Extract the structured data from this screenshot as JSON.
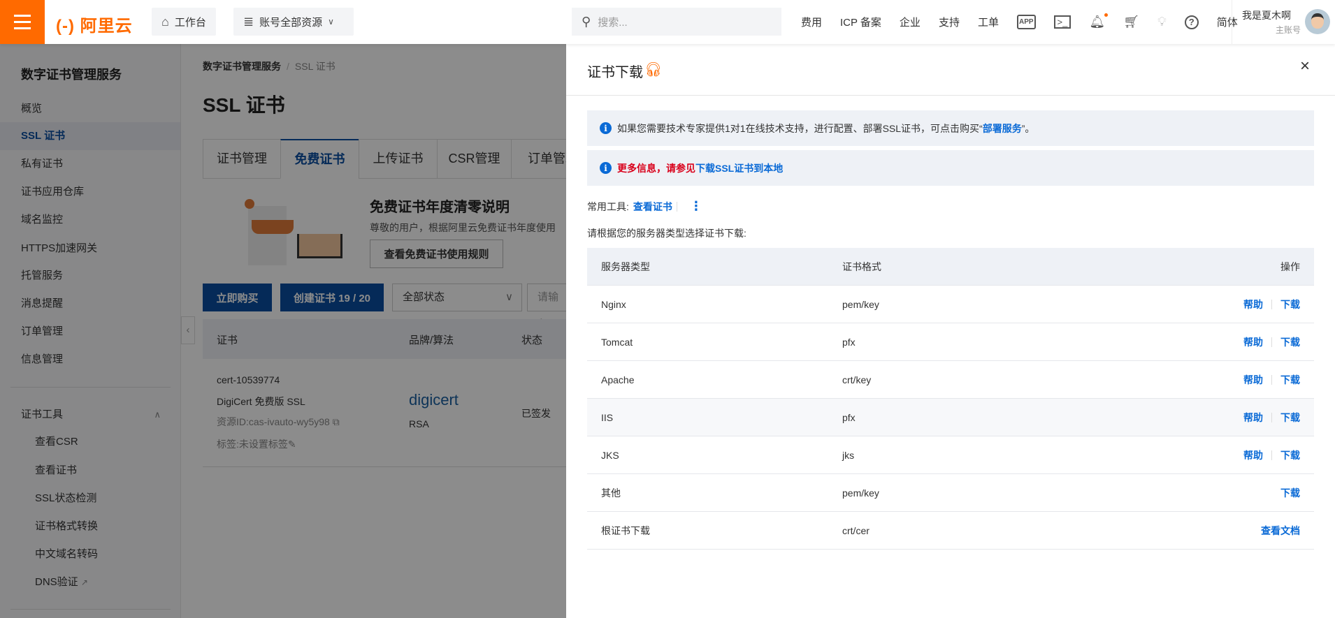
{
  "header": {
    "logo": "(-) 阿里云",
    "workbench": "工作台",
    "resources": "账号全部资源",
    "search_placeholder": "搜索...",
    "nav": [
      "费用",
      "ICP 备案",
      "企业",
      "支持",
      "工单"
    ],
    "lang": "简体",
    "user_name": "我是夏木啊",
    "user_role": "主账号",
    "accent": "#ff6a00"
  },
  "sidebar": {
    "title": "数字证书管理服务",
    "items": [
      "概览",
      "SSL 证书",
      "私有证书",
      "证书应用仓库",
      "域名监控",
      "HTTPS加速网关",
      "托管服务",
      "消息提醒",
      "订单管理",
      "信息管理"
    ],
    "active": "SSL 证书",
    "group": "证书工具",
    "sub_items": [
      "查看CSR",
      "查看证书",
      "SSL状态检测",
      "证书格式转换",
      "中文域名转码",
      "DNS验证"
    ]
  },
  "main": {
    "breadcrumb": [
      "数字证书管理服务",
      "SSL 证书"
    ],
    "title": "SSL 证书",
    "tabs": [
      "证书管理",
      "免费证书",
      "上传证书",
      "CSR管理",
      "订单管理"
    ],
    "active_tab": "免费证书",
    "banner": {
      "title": "免费证书年度清零说明",
      "desc": "尊敬的用户，根据阿里云免费证书年度使用",
      "button": "查看免费证书使用规则"
    },
    "buy": "立即购买",
    "create": "创建证书 19 / 20",
    "status_select": "全部状态",
    "input_placeholder": "请输入",
    "table": {
      "headers": [
        "证书",
        "品牌/算法",
        "状态"
      ],
      "row": {
        "id": "cert-10539774",
        "name": "DigiCert 免费版 SSL",
        "resource": "资源ID:cas-ivauto-wy5y98",
        "tag": "标签:未设置标签",
        "brand": "digicert",
        "algo": "RSA",
        "status": "已签发"
      }
    }
  },
  "drawer": {
    "title": "证书下载",
    "alert1_text": "如果您需要技术专家提供1对1在线技术支持，进行配置、部署SSL证书，可点击购买“",
    "alert1_link": "部署服务",
    "alert1_end": "”。",
    "alert2_red": "更多信息，请参见",
    "alert2_link": "下载SSL证书到本地",
    "tools_label": "常用工具:",
    "tools_link": "查看证书",
    "instruction": "请根据您的服务器类型选择证书下载:",
    "columns": [
      "服务器类型",
      "证书格式",
      "操作"
    ],
    "rows": [
      {
        "type": "Nginx",
        "format": "pem/key",
        "help": "帮助",
        "download": "下载"
      },
      {
        "type": "Tomcat",
        "format": "pfx",
        "help": "帮助",
        "download": "下载"
      },
      {
        "type": "Apache",
        "format": "crt/key",
        "help": "帮助",
        "download": "下载"
      },
      {
        "type": "IIS",
        "format": "pfx",
        "help": "帮助",
        "download": "下载"
      },
      {
        "type": "JKS",
        "format": "jks",
        "help": "帮助",
        "download": "下载"
      },
      {
        "type": "其他",
        "format": "pem/key",
        "download": "下载"
      },
      {
        "type": "根证书下载",
        "format": "crt/cer",
        "doc": "查看文档"
      }
    ]
  }
}
